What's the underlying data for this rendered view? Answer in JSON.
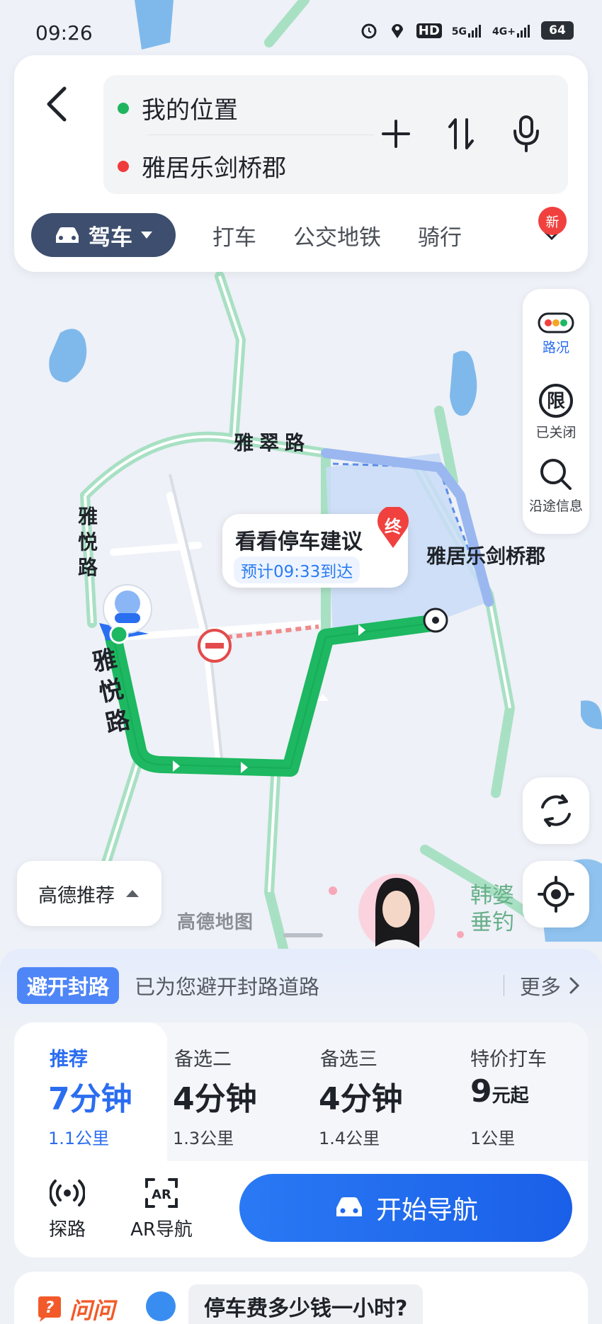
{
  "status_bar": {
    "time": "09:26",
    "network_labels": [
      "HD",
      "5G",
      "4G+"
    ],
    "battery": "64"
  },
  "route_input": {
    "origin": "我的位置",
    "destination": "雅居乐剑桥郡",
    "origin_dot_color": "#1fb55e",
    "destination_dot_color": "#ef3b3b"
  },
  "modes": {
    "active": "驾车",
    "items": [
      "打车",
      "公交地铁",
      "骑行"
    ],
    "new_badge": "新"
  },
  "right_tools": {
    "traffic": "路况",
    "restriction": "已关闭",
    "restriction_glyph": "限",
    "along_route": "沿途信息"
  },
  "map": {
    "road_labels": [
      "雅翠路",
      "雅悦路",
      "雅悦路"
    ],
    "destination_label": "雅居乐剑桥郡",
    "end_marker": "终",
    "tip_title": "看看停车建议",
    "tip_eta": "预计09:33到达",
    "watermark": "高德地图",
    "side_poi": "韩婆\n垂钓",
    "route_color": "#1db861"
  },
  "recommend_button": "高德推荐",
  "avoid": {
    "tag": "避开封路",
    "text": "已为您避开封路道路",
    "more": "更多"
  },
  "routes": [
    {
      "label": "推荐",
      "time": "7分钟",
      "distance": "1.1公里"
    },
    {
      "label": "备选二",
      "time": "4分钟",
      "distance": "1.3公里"
    },
    {
      "label": "备选三",
      "time": "4分钟",
      "distance": "1.4公里"
    },
    {
      "label": "特价打车",
      "price": "9",
      "price_unit": "元起",
      "distance": "1公里"
    }
  ],
  "actions": {
    "probe": "探路",
    "ar": "AR导航",
    "start": "开始导航"
  },
  "ask": {
    "logo": "问问",
    "question": "停车费多少钱一小时?"
  }
}
